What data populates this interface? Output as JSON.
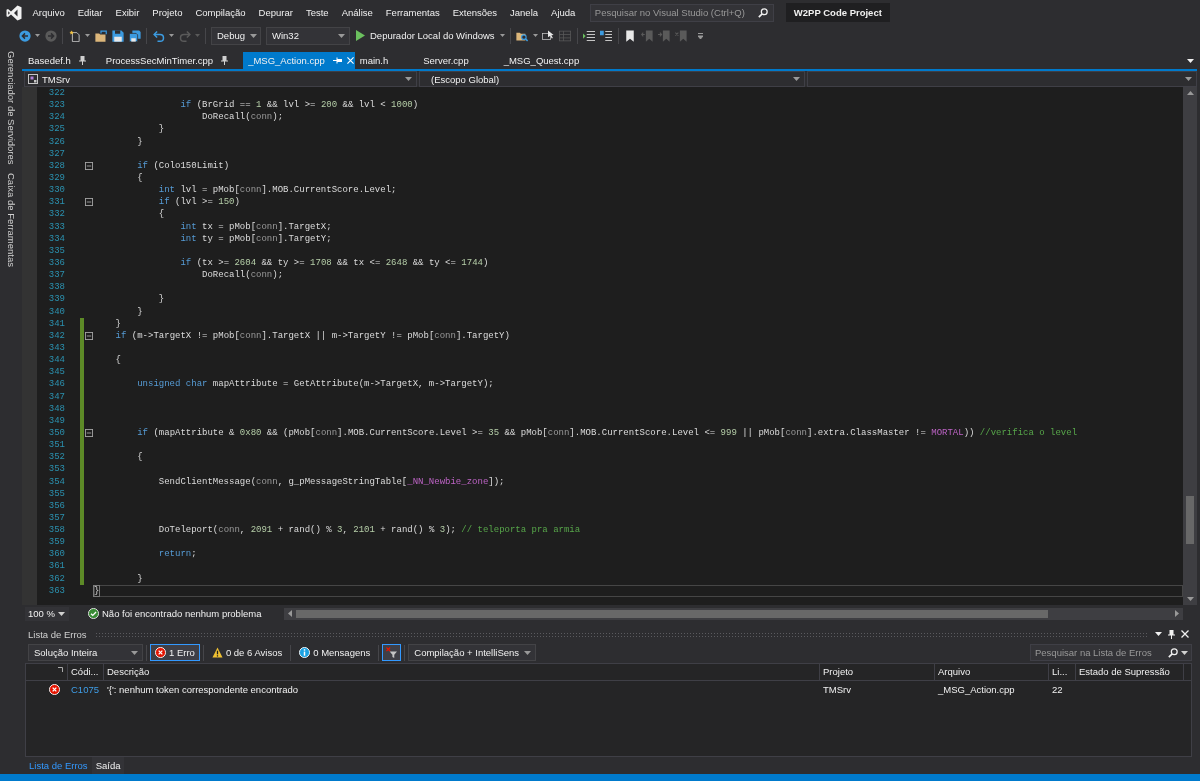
{
  "window": {
    "menu": [
      "Arquivo",
      "Editar",
      "Exibir",
      "Projeto",
      "Compilação",
      "Depurar",
      "Teste",
      "Análise",
      "Ferramentas",
      "Extensões",
      "Janela",
      "Ajuda"
    ],
    "search": {
      "placeholder": "Pesquisar no Visual Studio (Ctrl+Q)"
    },
    "project": "W2PP Code Project"
  },
  "toolbar": {
    "groups": [
      [
        {
          "kind": "back",
          "disabled": false
        },
        {
          "kind": "forward",
          "disabled": true
        }
      ],
      [
        {
          "kind": "new-item",
          "disabled": false
        },
        {
          "kind": "open",
          "disabled": false
        },
        {
          "kind": "save",
          "disabled": false
        },
        {
          "kind": "save-all",
          "disabled": false
        }
      ],
      [
        {
          "kind": "undo",
          "disabled": false
        },
        {
          "kind": "redo",
          "disabled": true
        }
      ]
    ],
    "configuration": "Debug",
    "platform": "Win32",
    "run_target": "Depurador Local do Windows",
    "tool_groups": [
      [
        {
          "kind": "find",
          "disabled": false
        },
        {
          "kind": "pointer",
          "disabled": false
        },
        {
          "kind": "grid",
          "disabled": true
        }
      ],
      [
        {
          "kind": "outdent",
          "disabled": false
        },
        {
          "kind": "comment",
          "disabled": false
        }
      ],
      [
        {
          "kind": "bookmark",
          "disabled": false
        },
        {
          "kind": "bookmark-prev",
          "disabled": true
        },
        {
          "kind": "bookmark-next",
          "disabled": true
        },
        {
          "kind": "bookmark-clear",
          "disabled": true
        }
      ]
    ]
  },
  "side_panels": [
    "Gerenciador de Servidores",
    "Caixa de Ferramentas"
  ],
  "tabs": [
    {
      "label": "Basedef.h",
      "pinned": true,
      "selected": false
    },
    {
      "label": "ProcessSecMinTimer.cpp",
      "pinned": true,
      "selected": false
    },
    {
      "label": "_MSG_Action.cpp",
      "pinned": false,
      "selected": true
    },
    {
      "label": "main.h",
      "pinned": false,
      "selected": false
    },
    {
      "label": "Server.cpp",
      "pinned": false,
      "selected": false
    },
    {
      "label": "_MSG_Quest.cpp",
      "pinned": false,
      "selected": false
    }
  ],
  "navigation": {
    "project": "TMSrv",
    "scope": "(Escopo Global)"
  },
  "code": {
    "lines": [
      {
        "number": "322",
        "changed": false,
        "fold": false,
        "current": false
      },
      {
        "number": "323",
        "changed": false,
        "fold": false,
        "current": false,
        "tokens": [
          {
            "kind": "keyword",
            "text": "                if"
          },
          {
            "kind": "plain",
            "text": " (BrGrid == "
          },
          {
            "kind": "number",
            "text": "1"
          },
          {
            "kind": "plain",
            "text": " && lvl >= "
          },
          {
            "kind": "number",
            "text": "200"
          },
          {
            "kind": "plain",
            "text": " && lvl < "
          },
          {
            "kind": "number",
            "text": "1000"
          },
          {
            "kind": "plain",
            "text": ")"
          }
        ]
      },
      {
        "number": "324",
        "changed": false,
        "fold": false,
        "current": false,
        "tokens": [
          {
            "kind": "plain",
            "text": "                    DoRecall("
          },
          {
            "kind": "parameter",
            "text": "conn"
          },
          {
            "kind": "plain",
            "text": ");"
          }
        ]
      },
      {
        "number": "325",
        "changed": false,
        "fold": false,
        "current": false,
        "tokens": [
          {
            "kind": "plain",
            "text": "            }"
          }
        ]
      },
      {
        "number": "326",
        "changed": false,
        "fold": false,
        "current": false,
        "tokens": [
          {
            "kind": "plain",
            "text": "        }"
          }
        ]
      },
      {
        "number": "327",
        "changed": false,
        "fold": false,
        "current": false
      },
      {
        "number": "328",
        "changed": false,
        "fold": true,
        "current": false,
        "tokens": [
          {
            "kind": "keyword",
            "text": "        if"
          },
          {
            "kind": "plain",
            "text": " (Colo150Limit)"
          }
        ]
      },
      {
        "number": "329",
        "changed": false,
        "fold": false,
        "current": false,
        "tokens": [
          {
            "kind": "plain",
            "text": "        {"
          }
        ]
      },
      {
        "number": "330",
        "changed": false,
        "fold": false,
        "current": false,
        "tokens": [
          {
            "kind": "keyword",
            "text": "            int"
          },
          {
            "kind": "plain",
            "text": " lvl = pMob["
          },
          {
            "kind": "parameter",
            "text": "conn"
          },
          {
            "kind": "plain",
            "text": "].MOB.CurrentScore.Level;"
          }
        ]
      },
      {
        "number": "331",
        "changed": false,
        "fold": true,
        "current": false,
        "tokens": [
          {
            "kind": "keyword",
            "text": "            if"
          },
          {
            "kind": "plain",
            "text": " (lvl >= "
          },
          {
            "kind": "number",
            "text": "150"
          },
          {
            "kind": "plain",
            "text": ")"
          }
        ]
      },
      {
        "number": "332",
        "changed": false,
        "fold": false,
        "current": false,
        "tokens": [
          {
            "kind": "plain",
            "text": "            {"
          }
        ]
      },
      {
        "number": "333",
        "changed": false,
        "fold": false,
        "current": false,
        "tokens": [
          {
            "kind": "keyword",
            "text": "                int"
          },
          {
            "kind": "plain",
            "text": " tx = pMob["
          },
          {
            "kind": "parameter",
            "text": "conn"
          },
          {
            "kind": "plain",
            "text": "].TargetX;"
          }
        ]
      },
      {
        "number": "334",
        "changed": false,
        "fold": false,
        "current": false,
        "tokens": [
          {
            "kind": "keyword",
            "text": "                int"
          },
          {
            "kind": "plain",
            "text": " ty = pMob["
          },
          {
            "kind": "parameter",
            "text": "conn"
          },
          {
            "kind": "plain",
            "text": "].TargetY;"
          }
        ]
      },
      {
        "number": "335",
        "changed": false,
        "fold": false,
        "current": false
      },
      {
        "number": "336",
        "changed": false,
        "fold": false,
        "current": false,
        "tokens": [
          {
            "kind": "keyword",
            "text": "                if"
          },
          {
            "kind": "plain",
            "text": " (tx >= "
          },
          {
            "kind": "number",
            "text": "2604"
          },
          {
            "kind": "plain",
            "text": " && ty >= "
          },
          {
            "kind": "number",
            "text": "1708"
          },
          {
            "kind": "plain",
            "text": " && tx <= "
          },
          {
            "kind": "number",
            "text": "2648"
          },
          {
            "kind": "plain",
            "text": " && ty <= "
          },
          {
            "kind": "number",
            "text": "1744"
          },
          {
            "kind": "plain",
            "text": ")"
          }
        ]
      },
      {
        "number": "337",
        "changed": false,
        "fold": false,
        "current": false,
        "tokens": [
          {
            "kind": "plain",
            "text": "                    DoRecall("
          },
          {
            "kind": "parameter",
            "text": "conn"
          },
          {
            "kind": "plain",
            "text": ");"
          }
        ]
      },
      {
        "number": "338",
        "changed": false,
        "fold": false,
        "current": false
      },
      {
        "number": "339",
        "changed": false,
        "fold": false,
        "current": false,
        "tokens": [
          {
            "kind": "plain",
            "text": "            }"
          }
        ]
      },
      {
        "number": "340",
        "changed": false,
        "fold": false,
        "current": false,
        "tokens": [
          {
            "kind": "plain",
            "text": "        }"
          }
        ]
      },
      {
        "number": "341",
        "changed": true,
        "fold": false,
        "current": false,
        "tokens": [
          {
            "kind": "plain",
            "text": "    }"
          }
        ]
      },
      {
        "number": "342",
        "changed": true,
        "fold": true,
        "current": false,
        "tokens": [
          {
            "kind": "keyword",
            "text": "    if"
          },
          {
            "kind": "plain",
            "text": " (m->TargetX != pMob["
          },
          {
            "kind": "parameter",
            "text": "conn"
          },
          {
            "kind": "plain",
            "text": "].TargetX || m->TargetY != pMob["
          },
          {
            "kind": "parameter",
            "text": "conn"
          },
          {
            "kind": "plain",
            "text": "].TargetY)"
          }
        ]
      },
      {
        "number": "343",
        "changed": true,
        "fold": false,
        "current": false
      },
      {
        "number": "344",
        "changed": true,
        "fold": false,
        "current": false,
        "tokens": [
          {
            "kind": "plain",
            "text": "    {"
          }
        ]
      },
      {
        "number": "345",
        "changed": true,
        "fold": false,
        "current": false
      },
      {
        "number": "346",
        "changed": true,
        "fold": false,
        "current": false,
        "tokens": [
          {
            "kind": "keyword",
            "text": "        unsigned char"
          },
          {
            "kind": "plain",
            "text": " mapAttribute = GetAttribute(m->TargetX, m->TargetY);"
          }
        ]
      },
      {
        "number": "347",
        "changed": true,
        "fold": false,
        "current": false
      },
      {
        "number": "348",
        "changed": true,
        "fold": false,
        "current": false
      },
      {
        "number": "349",
        "changed": true,
        "fold": false,
        "current": false
      },
      {
        "number": "350",
        "changed": true,
        "fold": true,
        "current": false,
        "tokens": [
          {
            "kind": "keyword",
            "text": "        if"
          },
          {
            "kind": "plain",
            "text": " (mapAttribute & "
          },
          {
            "kind": "number",
            "text": "0x80"
          },
          {
            "kind": "plain",
            "text": " && (pMob["
          },
          {
            "kind": "parameter",
            "text": "conn"
          },
          {
            "kind": "plain",
            "text": "].MOB.CurrentScore.Level >= "
          },
          {
            "kind": "number",
            "text": "35"
          },
          {
            "kind": "plain",
            "text": " && pMob["
          },
          {
            "kind": "parameter",
            "text": "conn"
          },
          {
            "kind": "plain",
            "text": "].MOB.CurrentScore.Level <= "
          },
          {
            "kind": "number",
            "text": "999"
          },
          {
            "kind": "plain",
            "text": " || pMob["
          },
          {
            "kind": "parameter",
            "text": "conn"
          },
          {
            "kind": "plain",
            "text": "].extra.ClassMaster != "
          },
          {
            "kind": "macro",
            "text": "MORTAL"
          },
          {
            "kind": "plain",
            "text": ")) "
          },
          {
            "kind": "comment",
            "text": "//verifica o level"
          }
        ]
      },
      {
        "number": "351",
        "changed": true,
        "fold": false,
        "current": false
      },
      {
        "number": "352",
        "changed": true,
        "fold": false,
        "current": false,
        "tokens": [
          {
            "kind": "plain",
            "text": "        {"
          }
        ]
      },
      {
        "number": "353",
        "changed": true,
        "fold": false,
        "current": false
      },
      {
        "number": "354",
        "changed": true,
        "fold": false,
        "current": false,
        "tokens": [
          {
            "kind": "plain",
            "text": "            SendClientMessage("
          },
          {
            "kind": "parameter",
            "text": "conn"
          },
          {
            "kind": "plain",
            "text": ", g_pMessageStringTable["
          },
          {
            "kind": "macro",
            "text": "_NN_Newbie_zone"
          },
          {
            "kind": "plain",
            "text": "]);"
          }
        ]
      },
      {
        "number": "355",
        "changed": true,
        "fold": false,
        "current": false
      },
      {
        "number": "356",
        "changed": true,
        "fold": false,
        "current": false
      },
      {
        "number": "357",
        "changed": true,
        "fold": false,
        "current": false
      },
      {
        "number": "358",
        "changed": true,
        "fold": false,
        "current": false,
        "tokens": [
          {
            "kind": "plain",
            "text": "            DoTeleport("
          },
          {
            "kind": "parameter",
            "text": "conn"
          },
          {
            "kind": "plain",
            "text": ", "
          },
          {
            "kind": "number",
            "text": "2091"
          },
          {
            "kind": "plain",
            "text": " + rand() % "
          },
          {
            "kind": "number",
            "text": "3"
          },
          {
            "kind": "plain",
            "text": ", "
          },
          {
            "kind": "number",
            "text": "2101"
          },
          {
            "kind": "plain",
            "text": " + rand() % "
          },
          {
            "kind": "number",
            "text": "3"
          },
          {
            "kind": "plain",
            "text": "); "
          },
          {
            "kind": "comment",
            "text": "// teleporta pra armia"
          }
        ]
      },
      {
        "number": "359",
        "changed": true,
        "fold": false,
        "current": false
      },
      {
        "number": "360",
        "changed": true,
        "fold": false,
        "current": false,
        "tokens": [
          {
            "kind": "keyword",
            "text": "            return"
          },
          {
            "kind": "plain",
            "text": ";"
          }
        ]
      },
      {
        "number": "361",
        "changed": true,
        "fold": false,
        "current": false
      },
      {
        "number": "362",
        "changed": true,
        "fold": false,
        "current": false,
        "tokens": [
          {
            "kind": "plain",
            "text": "        }"
          }
        ]
      },
      {
        "number": "363",
        "changed": false,
        "fold": false,
        "current": true,
        "tokens": [
          {
            "kind": "brace_match",
            "text": "}"
          }
        ]
      }
    ]
  },
  "editor_status": {
    "zoom": "100 %",
    "message": "Não foi encontrado nenhum problema"
  },
  "error_list": {
    "title": "Lista de Erros",
    "scope": "Solução Inteira",
    "filters": [
      {
        "kind": "error",
        "label": "1 Erro",
        "selected": true
      },
      {
        "kind": "warning",
        "label": "0 de 6 Avisos",
        "selected": false
      },
      {
        "kind": "info",
        "label": "0 Mensagens",
        "selected": false
      }
    ],
    "filter_toggle": {
      "selected": true
    },
    "source": "Compilação + IntelliSens",
    "search": {
      "placeholder": "Pesquisar na Lista de Erros"
    },
    "columns": [
      "Códi...",
      "Descrição",
      "Projeto",
      "Arquivo",
      "Li...",
      "Estado de Supressão"
    ],
    "rows": [
      {
        "kind": "error",
        "code": "C1075",
        "description": "'{': nenhum token correspondente encontrado",
        "project": "TMSrv",
        "file": "_MSG_Action.cpp",
        "line": "22"
      }
    ]
  },
  "bottom_tabs": [
    {
      "label": "Lista de Erros",
      "selected": true
    },
    {
      "label": "Saída",
      "selected": false
    }
  ]
}
